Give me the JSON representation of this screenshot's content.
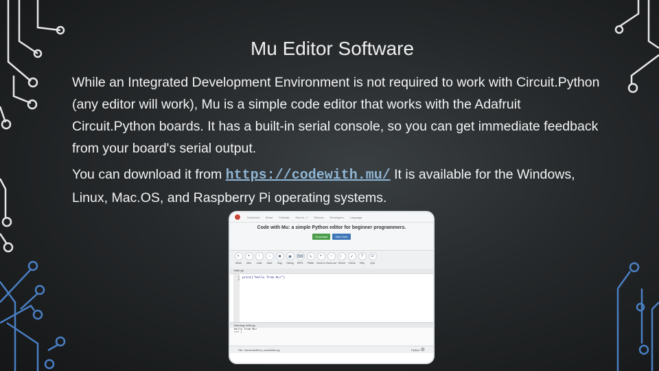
{
  "slide": {
    "title": "Mu Editor Software",
    "paragraph1": "While an Integrated Development Environment is not required to work with Circuit.Python (any editor will work), Mu is a simple code editor that works with the Adafruit Circuit.Python boards.  It has a built-in serial console, so you can get immediate feedback from your board's serial output.",
    "paragraph2_before": "You can download it from ",
    "paragraph2_link": "https://codewith.mu/",
    "paragraph2_after": " It is available for the Windows, Linux, Mac.OS, and Raspberry Pi operating systems."
  },
  "screenshot": {
    "nav": [
      "Download",
      "About",
      "Tutorials",
      "How to...?",
      "Discuss",
      "Developers",
      "Language"
    ],
    "hero_title": "Code with Mu: a simple Python editor for beginner programmers.",
    "download_label": "Download",
    "start_label": "Start Here",
    "tools": [
      {
        "icon": "mode-icon",
        "glyph": "◐",
        "label": "Mode"
      },
      {
        "icon": "new-icon",
        "glyph": "+",
        "label": "New"
      },
      {
        "icon": "load-icon",
        "glyph": "↑",
        "label": "Load"
      },
      {
        "icon": "save-icon",
        "glyph": "↓",
        "label": "Save"
      },
      {
        "icon": "bug-icon",
        "glyph": "✖",
        "label": "Bug"
      },
      {
        "icon": "debug-icon",
        "glyph": "◉",
        "label": "Debug"
      },
      {
        "icon": "repl-icon",
        "glyph": "⌨",
        "label": "REPL"
      },
      {
        "icon": "plotter-icon",
        "glyph": "∿",
        "label": "Plotter"
      },
      {
        "icon": "zoom-in-icon",
        "glyph": "+",
        "label": "Zoom-in"
      },
      {
        "icon": "zoom-out-icon",
        "glyph": "−",
        "label": "Zoom-out"
      },
      {
        "icon": "theme-icon",
        "glyph": "☾",
        "label": "Theme"
      },
      {
        "icon": "check-icon",
        "glyph": "✓",
        "label": "Check"
      },
      {
        "icon": "help-icon",
        "glyph": "?",
        "label": "Help"
      },
      {
        "icon": "quit-icon",
        "glyph": "⏻",
        "label": "Quit"
      }
    ],
    "file_tab": "hello.py",
    "line_numbers": "1\n2",
    "code": "print(\"Hello from Mu!\")",
    "console_header": "Running: hello.py",
    "console_output": "Hello from Mu!\n>>> |",
    "status_path": "File: /home/ntoll/mu_code/hello.py",
    "status_mode": "Python"
  },
  "colors": {
    "link": "#8fb6d6",
    "download_button": "#4a9e4a",
    "start_button": "#3d77b8",
    "circuit_trace": "#4a7fc4"
  }
}
